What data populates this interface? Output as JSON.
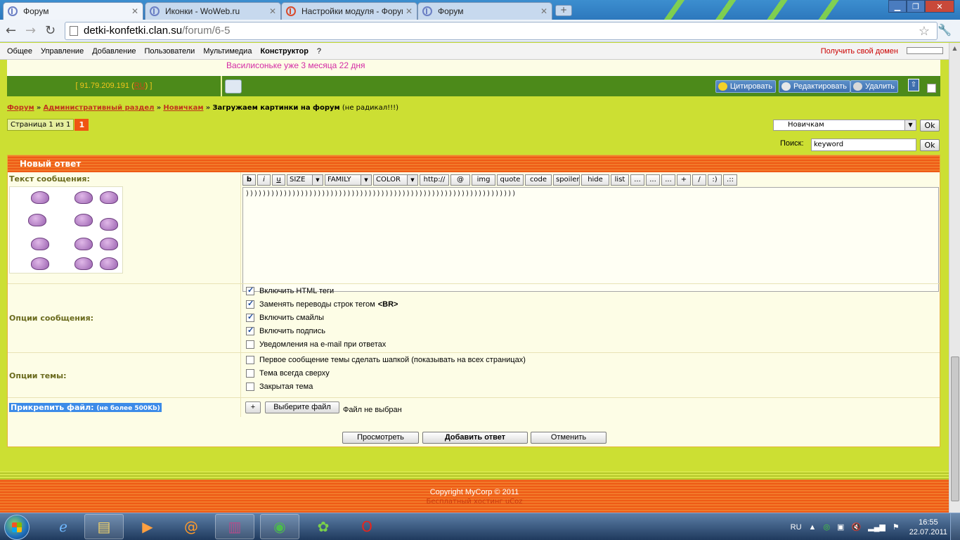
{
  "browser": {
    "tabs": [
      {
        "label": "Форум",
        "favicon": "ucoz-icon"
      },
      {
        "label": "Иконки - WoWeb.ru",
        "favicon": "ucoz-icon"
      },
      {
        "label": "Настройки модуля - Форум",
        "favicon": "opera-icon"
      },
      {
        "label": "Форум",
        "favicon": "ucoz-icon"
      }
    ],
    "url_host": "detki-konfetki.clan.su",
    "url_path": "/forum/6-5"
  },
  "adminbar": {
    "items": [
      "Общее",
      "Управление",
      "Добавление",
      "Пользователи",
      "Мультимедиа",
      "Конструктор",
      "?"
    ],
    "domain_link": "Получить свой домен"
  },
  "post": {
    "signature": "Василисоньке уже  3 месяца 22 дня",
    "ip": "91.79.209.191",
    "country": "RU",
    "actions": {
      "quote": "Цитировать",
      "edit": "Редактировать",
      "delete": "Удалить"
    }
  },
  "breadcrumb": {
    "forum": "Форум",
    "section": "Административный раздел",
    "subforum": "Новичкам",
    "topic": "Загружаем картинки на форум",
    "note": "(не радикал!!!)",
    "sep": "»"
  },
  "pager": {
    "info": "Страница 1 из 1",
    "current": "1"
  },
  "jump": {
    "selected": "Новичкам",
    "ok": "Ok"
  },
  "search": {
    "label": "Поиск:",
    "value": "keyword",
    "ok": "Ok"
  },
  "form": {
    "title": "Новый ответ",
    "text_label": "Текст сообщения:",
    "bbcodes": [
      "b",
      "i",
      "u",
      "SIZE",
      "FAMILY",
      "COLOR",
      "http://",
      "@",
      "img",
      "quote",
      "code",
      "spoiler",
      "hide",
      "list",
      "...",
      "...",
      "...",
      "+",
      "/",
      ":)",
      ".::"
    ],
    "message": "))))))))))))))))))))))))))))))))))))))))))))))))))))))))))))))))",
    "msg_options_label": "Опции сообщения:",
    "msg_options": [
      {
        "label": "Включить HTML теги",
        "checked": true
      },
      {
        "label": "Заменять переводы строк тегом",
        "extra": "<BR>",
        "checked": true
      },
      {
        "label": "Включить смайлы",
        "checked": true
      },
      {
        "label": "Включить подпись",
        "checked": true
      },
      {
        "label": "Уведомления на e-mail при ответах",
        "checked": false
      }
    ],
    "topic_options_label": "Опции темы:",
    "topic_options": [
      {
        "label": "Первое сообщение темы сделать шапкой (показывать на всех страницах)",
        "checked": false
      },
      {
        "label": "Тема всегда сверху",
        "checked": false
      },
      {
        "label": "Закрытая тема",
        "checked": false
      }
    ],
    "attach_label": "Прикрепить файл:",
    "attach_limit": "(не более 500Kb)",
    "add_file": "+",
    "choose_file": "Выберите файл",
    "no_file": "Файл не выбран",
    "preview": "Просмотреть",
    "submit": "Добавить ответ",
    "cancel": "Отменить"
  },
  "footer": {
    "copyright": "Copyright MyCorp © 2011",
    "hosting": "Бесплатный хостинг uCoz"
  },
  "taskbar": {
    "lang": "RU",
    "time": "16:55",
    "date": "22.07.2011"
  },
  "colors": {
    "accent_orange": "#f05412",
    "page_bg": "#ccdf33",
    "post_bar": "#4c8a1a",
    "link": "#c0361c"
  }
}
